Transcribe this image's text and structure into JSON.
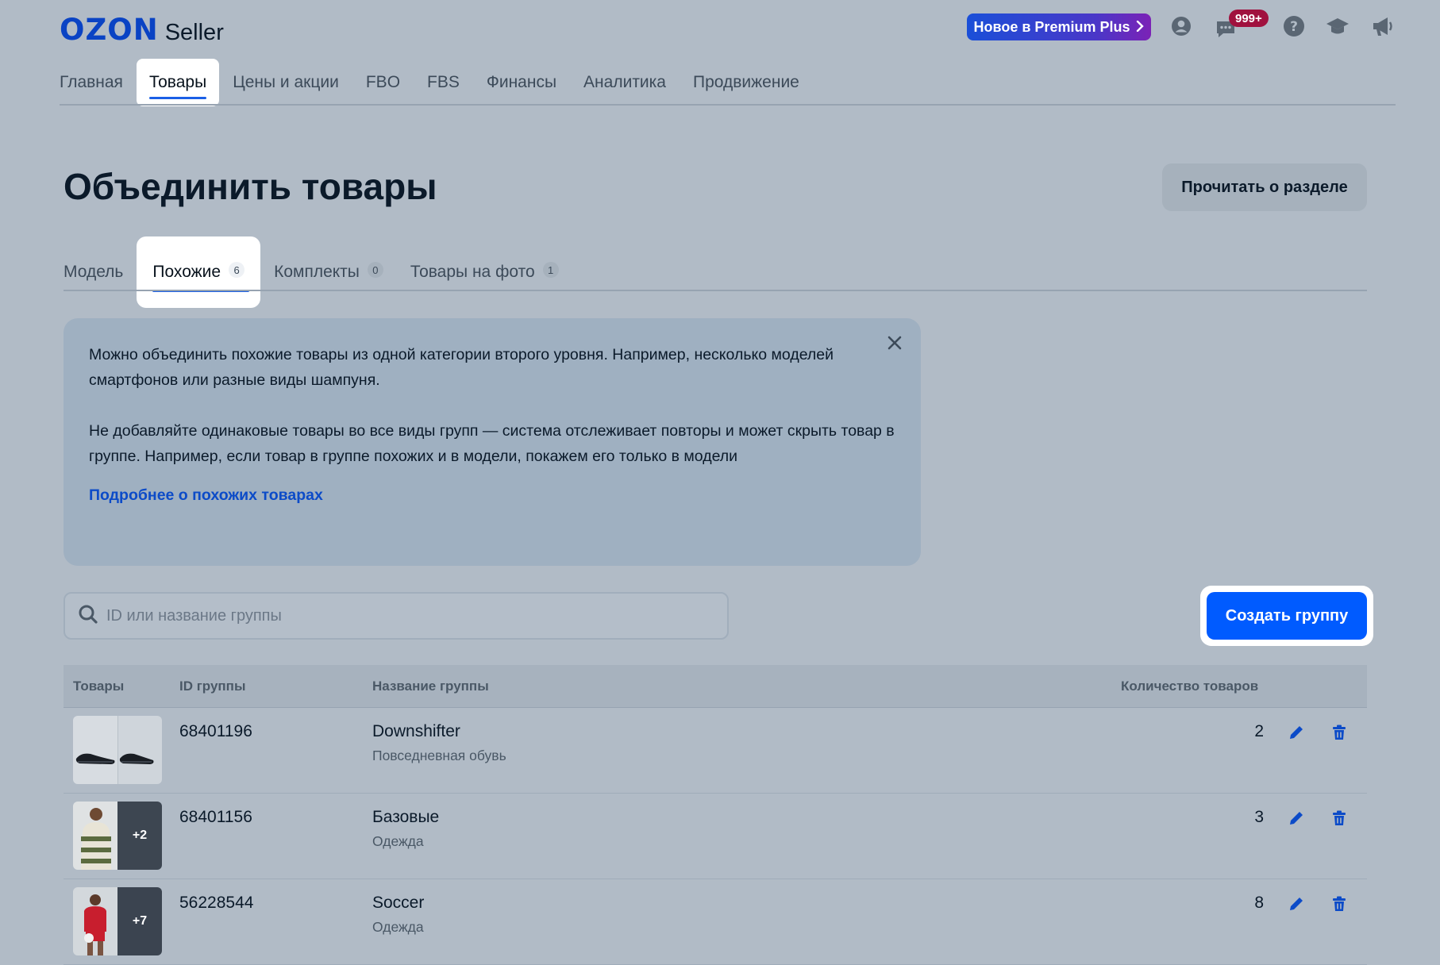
{
  "header": {
    "logo_ozon": "OZON",
    "logo_seller": "Seller",
    "premium_label": "Новое в Premium Plus",
    "notifications_badge": "999+",
    "icons": [
      "user-icon",
      "chat-icon",
      "help-icon",
      "education-icon",
      "megaphone-icon"
    ]
  },
  "nav": {
    "items": [
      {
        "label": "Главная"
      },
      {
        "label": "Товары",
        "active": true
      },
      {
        "label": "Цены и акции"
      },
      {
        "label": "FBO"
      },
      {
        "label": "FBS"
      },
      {
        "label": "Финансы"
      },
      {
        "label": "Аналитика"
      },
      {
        "label": "Продвижение"
      }
    ]
  },
  "page": {
    "title": "Объединить товары",
    "read_button": "Прочитать о разделе"
  },
  "tabs": [
    {
      "label": "Модель",
      "count": ""
    },
    {
      "label": "Похожие",
      "count": "6",
      "active": true
    },
    {
      "label": "Комплекты",
      "count": "0"
    },
    {
      "label": "Товары на фото",
      "count": "1"
    }
  ],
  "info": {
    "paragraph1": "Можно объединить похожие товары из одной категории второго уровня. Например, несколько моделей смартфонов или разные виды шампуня.",
    "paragraph2": "Не добавляйте одинаковые товары во все виды групп — система отслеживает повторы и может скрыть товар в группе. Например, если товар в группе похожих и в модели, покажем его только в модели",
    "link": "Подробнее о похожих товарах"
  },
  "search": {
    "placeholder": "ID или название группы",
    "value": ""
  },
  "create_button": "Создать группу",
  "table": {
    "columns": [
      "Товары",
      "ID группы",
      "Название группы",
      "Количество товаров"
    ],
    "rows": [
      {
        "id": "68401196",
        "name": "Downshifter",
        "category": "Повседневная обувь",
        "qty": "2",
        "extra": ""
      },
      {
        "id": "68401156",
        "name": "Базовые",
        "category": "Одежда",
        "qty": "3",
        "extra": "+2"
      },
      {
        "id": "56228544",
        "name": "Soccer",
        "category": "Одежда",
        "qty": "8",
        "extra": "+7"
      }
    ]
  },
  "colors": {
    "accent": "#005bff",
    "link": "#0c4bc8",
    "badge": "#a0113e",
    "background": "#b1bbc6"
  }
}
